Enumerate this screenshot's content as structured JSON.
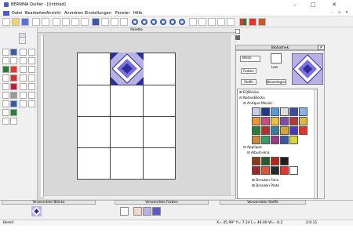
{
  "title_bar": {
    "app_title": "BERNINA Quilter - [Untitled]",
    "minimize": "–",
    "maximize": "□",
    "close": "✕"
  },
  "menu": {
    "items": [
      "Datei",
      "Bearbeiten",
      "Ansicht",
      "Anordnen",
      "Einstellungen",
      "Fenster",
      "Hilfe"
    ],
    "right_controls": [
      "–",
      "▫",
      "✕"
    ]
  },
  "palette": {
    "label": "Palette"
  },
  "library": {
    "title": "Bibliothek",
    "close": "✕",
    "block_label": "Block",
    "fill_label": "Leer",
    "pattern_button": "Farben",
    "edit_button": "Stoffe",
    "new_button": "Neuanlegen",
    "tree": [
      {
        "label": "EQBlöcke",
        "level": 0
      },
      {
        "label": "NativeBlocks",
        "level": 0
      },
      {
        "label": "Antique Mosaic",
        "level": 1
      },
      {
        "label": "Applique",
        "level": 1
      },
      {
        "label": "Album-Ana",
        "level": 2
      },
      {
        "label": "Dresden Fans",
        "level": 2
      },
      {
        "label": "Dresden Plate",
        "level": 2
      }
    ]
  },
  "bottom_panel": {
    "blocks_header": "Verwendete Blöcke",
    "fabrics_header": "Verwendete Farben",
    "stoffe_header": "Verwendete Stoffe"
  },
  "status": {
    "left": "Bereit",
    "coords": "X= 45.99\"   Y= 7.24 L=  48.00 W=   -0.2",
    "zoom": "2:0.11"
  },
  "colors": {
    "block_light": "#b8b0e6",
    "block_dark": "#2b2f9a",
    "block_mid": "#7a6ee0",
    "accent_red": "#e3352f",
    "accent_green": "#2d7d3a"
  },
  "swatches": [
    "#ffffff",
    "#f2d7c4",
    "#b8b0e6",
    "#5a5ac8"
  ]
}
